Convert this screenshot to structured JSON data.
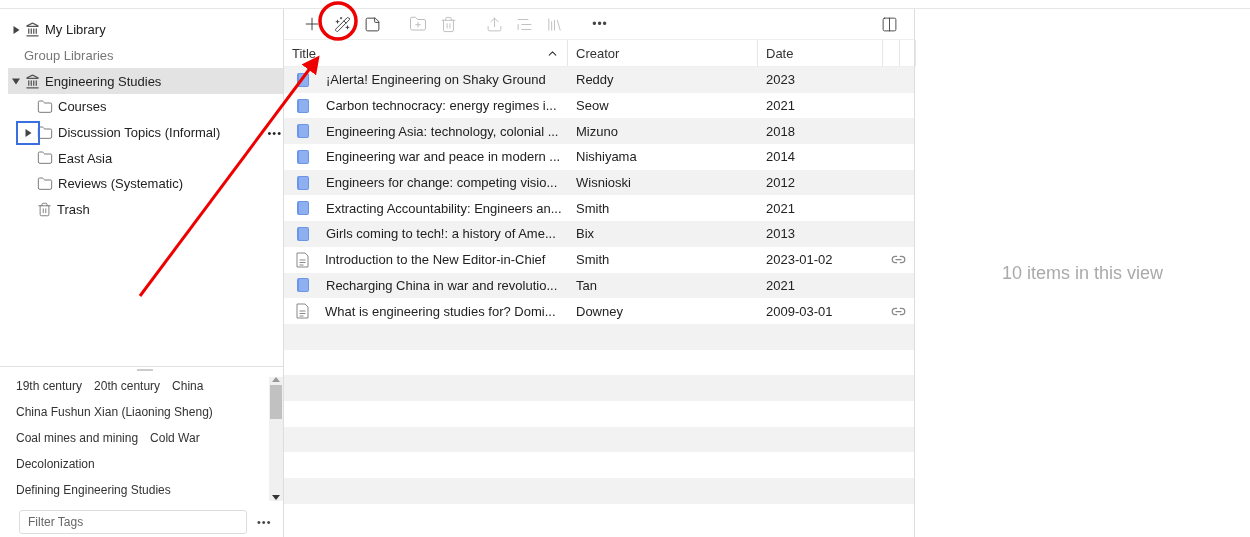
{
  "collections": [
    {
      "kind": "library",
      "label": "My Library",
      "expanded": false,
      "selected": false
    },
    {
      "kind": "header",
      "label": "Group Libraries"
    },
    {
      "kind": "library",
      "label": "Engineering Studies",
      "expanded": true,
      "selected": true,
      "children": [
        {
          "kind": "folder",
          "label": "Courses",
          "selected": false
        },
        {
          "kind": "folder",
          "label": "Discussion Topics (Informal)",
          "expanded": false,
          "selected": false,
          "hovered": true,
          "menu": "•••"
        },
        {
          "kind": "folder",
          "label": "East Asia",
          "selected": false
        },
        {
          "kind": "folder",
          "label": "Reviews (Systematic)",
          "selected": false
        },
        {
          "kind": "trash",
          "label": "Trash",
          "selected": false
        }
      ]
    }
  ],
  "tags": [
    "19th century",
    "20th century",
    "China",
    "China Fushun Xian (Liaoning Sheng)",
    "Coal mines and mining",
    "Cold War",
    "Decolonization",
    "Defining Engineering Studies"
  ],
  "tag_filter": {
    "placeholder": "Filter Tags",
    "menu": "•••"
  },
  "toolbar": {
    "more": "•••"
  },
  "table": {
    "columns": [
      "Title",
      "Creator",
      "Date"
    ],
    "rows": [
      {
        "kind": "book",
        "title": "¡Alerta! Engineering on Shaky Ground",
        "creator": "Reddy",
        "date": "2023",
        "link": false
      },
      {
        "kind": "book",
        "title": "Carbon technocracy: energy regimes i...",
        "creator": "Seow",
        "date": "2021",
        "link": false
      },
      {
        "kind": "book",
        "title": "Engineering Asia: technology, colonial ...",
        "creator": "Mizuno",
        "date": "2018",
        "link": false
      },
      {
        "kind": "book",
        "title": "Engineering war and peace in modern ...",
        "creator": "Nishiyama",
        "date": "2014",
        "link": false
      },
      {
        "kind": "book",
        "title": "Engineers for change: competing visio...",
        "creator": "Wisnioski",
        "date": "2012",
        "link": false
      },
      {
        "kind": "book",
        "title": "Extracting Accountability: Engineers an...",
        "creator": "Smith",
        "date": "2021",
        "link": false
      },
      {
        "kind": "book",
        "title": "Girls coming to tech!: a history of Ame...",
        "creator": "Bix",
        "date": "2013",
        "link": false
      },
      {
        "kind": "document",
        "title": "Introduction to the New Editor-in-Chief",
        "creator": "Smith",
        "date": "2023-01-02",
        "link": true
      },
      {
        "kind": "book",
        "title": "Recharging China in war and revolutio...",
        "creator": "Tan",
        "date": "2021",
        "link": false
      },
      {
        "kind": "document",
        "title": "What is engineering studies for? Domi...",
        "creator": "Downey",
        "date": "2009-03-01",
        "link": true
      }
    ]
  },
  "item_pane": {
    "message": "10 items in this view"
  }
}
